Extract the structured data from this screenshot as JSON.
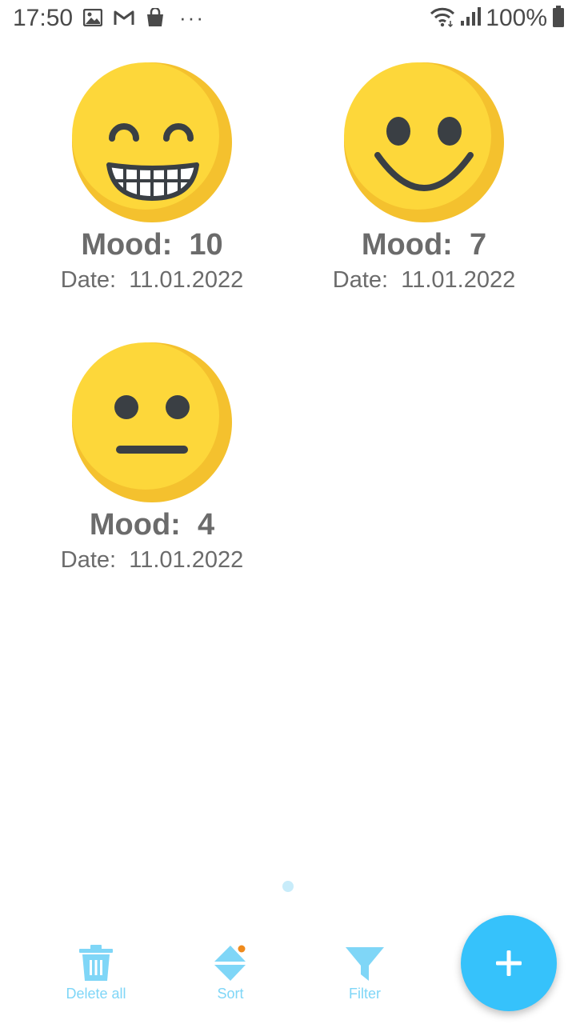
{
  "status_bar": {
    "time": "17:50",
    "battery": "100%",
    "icons_left": [
      "image-icon",
      "gmail-icon",
      "shopping-bag-icon",
      "more-icon"
    ],
    "icons_right": [
      "wifi-icon",
      "signal-icon",
      "battery-icon"
    ]
  },
  "moods": [
    {
      "mood_label": "Mood:",
      "mood_value": "10",
      "date_label": "Date:",
      "date": "11.01.2022",
      "face": "grinning-face-icon"
    },
    {
      "mood_label": "Mood:",
      "mood_value": "7",
      "date_label": "Date:",
      "date": "11.01.2022",
      "face": "smiling-face-icon"
    },
    {
      "mood_label": "Mood:",
      "mood_value": "4",
      "date_label": "Date:",
      "date": "11.01.2022",
      "face": "neutral-face-icon"
    }
  ],
  "toolbar": {
    "delete_all_label": "Delete all",
    "sort_label": "Sort",
    "filter_label": "Filter",
    "add_icon": "plus-icon"
  },
  "colors": {
    "accent": "#36c2fb",
    "toolbar_text": "#7fd6f7",
    "face_yellow": "#fdd73a",
    "face_shade": "#f4c12e",
    "face_features": "#3a3f44",
    "text_gray": "#6b6b6b",
    "sort_badge": "#ef8a1c"
  }
}
